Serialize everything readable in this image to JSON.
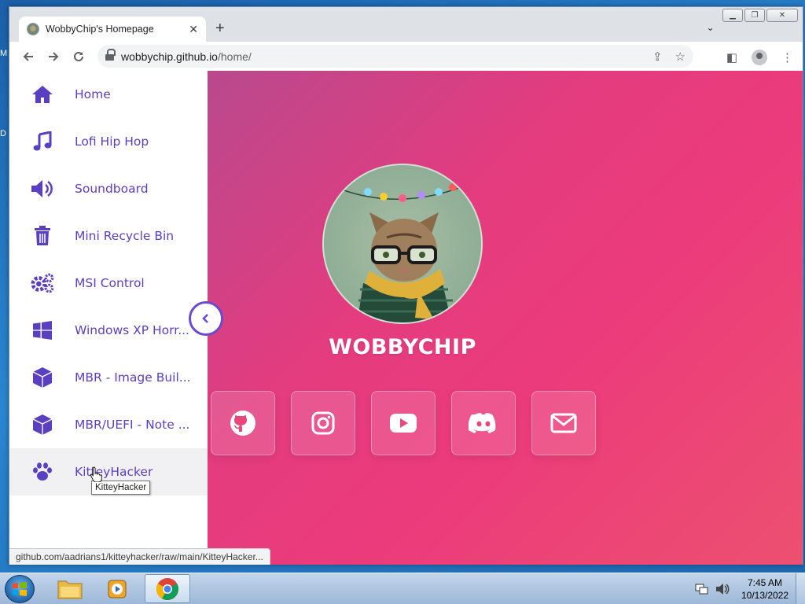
{
  "desktop": {
    "letters": [
      "M",
      "D"
    ]
  },
  "window": {
    "caption_buttons": [
      "minimize",
      "maximize",
      "close"
    ]
  },
  "tab": {
    "title": "WobbyChip's Homepage"
  },
  "address": {
    "host": "wobbychip.github.io",
    "path": "/home/"
  },
  "sidebar": {
    "items": [
      {
        "label": "Home",
        "icon": "home-icon"
      },
      {
        "label": "Lofi Hip Hop",
        "icon": "music-icon"
      },
      {
        "label": "Soundboard",
        "icon": "speaker-icon"
      },
      {
        "label": "Mini Recycle Bin",
        "icon": "trash-icon"
      },
      {
        "label": "MSI Control",
        "icon": "gears-icon"
      },
      {
        "label": "Windows XP Horr...",
        "icon": "windows-icon"
      },
      {
        "label": "MBR - Image Buil...",
        "icon": "cube-icon"
      },
      {
        "label": "MBR/UEFI - Note ...",
        "icon": "cube-icon"
      },
      {
        "label": "KitteyHacker",
        "icon": "paw-icon"
      }
    ]
  },
  "main": {
    "title": "WOBBYCHIP",
    "socials": [
      "github-icon",
      "instagram-icon",
      "youtube-icon",
      "discord-icon",
      "email-icon"
    ]
  },
  "tooltip": {
    "text": "KitteyHacker"
  },
  "status": {
    "url": "github.com/aadrians1/kitteyhacker/raw/main/KitteyHacker..."
  },
  "taskbar": {
    "time": "7:45 AM",
    "date": "10/13/2022"
  },
  "colors": {
    "accent": "#5a3fc0",
    "page_bg": "#ec3b7b"
  }
}
